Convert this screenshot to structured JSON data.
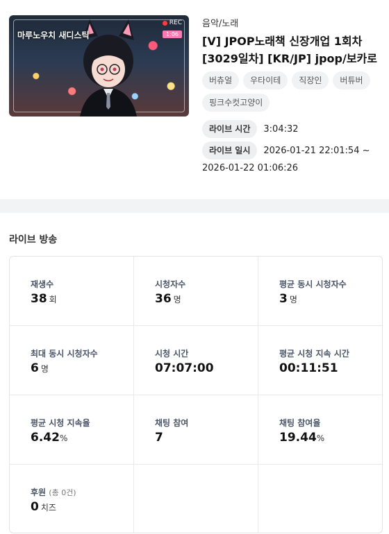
{
  "video": {
    "thumbnail": {
      "title_overlay": "마루노우치 새디스틱",
      "rec_label": "REC",
      "time_badge": "1:06"
    },
    "category": "음악/노래",
    "title": "[V] JPOP노래책 신장개업 1회차 [3029일차] [KR/JP] jpop/보카로",
    "tags": [
      "버츄얼",
      "우타이테",
      "직장인",
      "버튜버",
      "핑크수컷고양이"
    ],
    "live_time_label": "라이브 시간",
    "live_time_value": "3:04:32",
    "live_date_label": "라이브 일시",
    "live_date_start": "2026-01-21 22:01:54 ~",
    "live_date_end": "2026-01-22 01:06:26"
  },
  "stats": {
    "section_title": "라이브 방송",
    "items": [
      {
        "label": "재생수",
        "value": "38",
        "unit": "회"
      },
      {
        "label": "시청자수",
        "value": "36",
        "unit": "명"
      },
      {
        "label": "평균 동시 시청자수",
        "value": "3",
        "unit": "명"
      },
      {
        "label": "최대 동시 시청자수",
        "value": "6",
        "unit": "명"
      },
      {
        "label": "시청 시간",
        "value": "07:07:00",
        "unit": ""
      },
      {
        "label": "평균 시청 지속 시간",
        "value": "00:11:51",
        "unit": ""
      },
      {
        "label": "평균 시청 지속율",
        "value": "6.42",
        "unit": "%"
      },
      {
        "label": "채팅 참여",
        "value": "7",
        "unit": ""
      },
      {
        "label": "채팅 참여율",
        "value": "19.44",
        "unit": "%"
      },
      {
        "label": "후원",
        "sub": "(총 0건)",
        "value": "0",
        "unit": "치즈"
      }
    ]
  },
  "colors": {
    "accent_rec": "#ff3b3b",
    "tag_bg": "#f1f2f4",
    "page_bg": "#f2f3f5"
  }
}
